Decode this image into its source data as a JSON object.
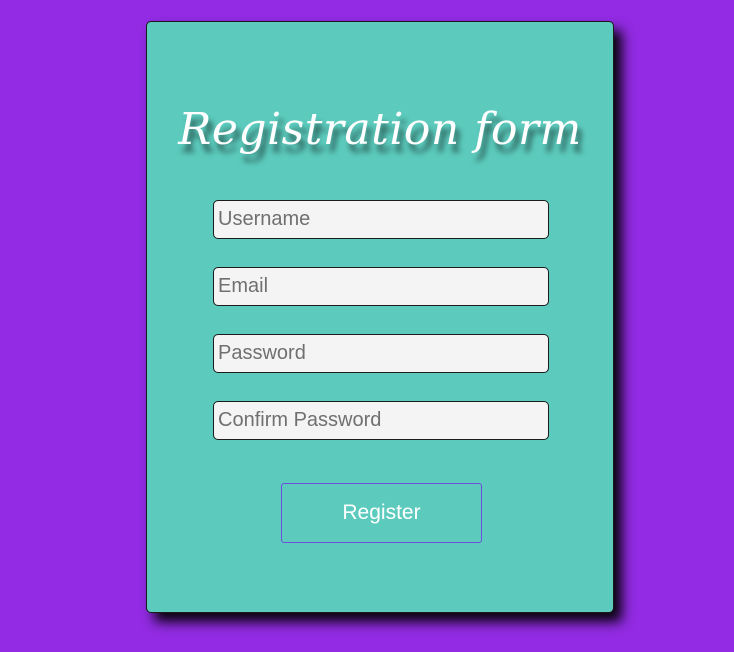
{
  "form": {
    "title": "Registration form",
    "fields": [
      {
        "name": "username",
        "placeholder": "Username",
        "value": ""
      },
      {
        "name": "email",
        "placeholder": "Email",
        "value": ""
      },
      {
        "name": "password",
        "placeholder": "Password",
        "value": ""
      },
      {
        "name": "confirm_password",
        "placeholder": "Confirm Password",
        "value": ""
      }
    ],
    "submit_label": "Register"
  },
  "colors": {
    "page_background": "#922be3",
    "card_background": "#5ccbbd",
    "input_background": "#f4f4f4",
    "button_border": "#6d4fd9",
    "text_light": "#ffffff"
  }
}
